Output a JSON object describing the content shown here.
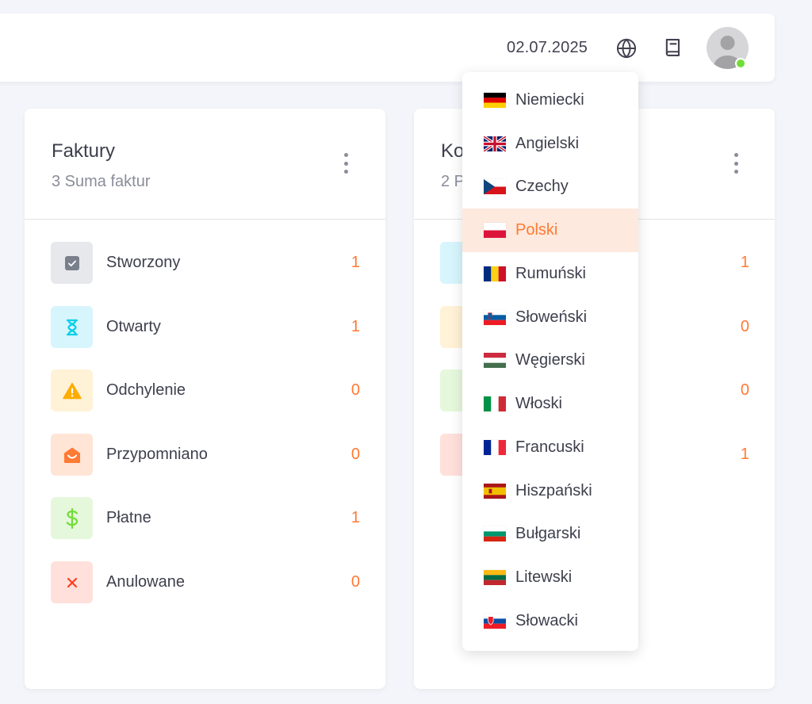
{
  "header": {
    "date": "02.07.2025",
    "icons": [
      "globe-icon",
      "book-icon"
    ],
    "online_status_color": "#71dd37"
  },
  "cards": [
    {
      "title": "Faktury",
      "subtitle": "3 Suma faktur",
      "rows": [
        {
          "label": "Stworzony",
          "count": "1",
          "icon": "checkbox-icon",
          "bg": "#e7e8ec",
          "fg": "#7a7f8c"
        },
        {
          "label": "Otwarty",
          "count": "1",
          "icon": "hourglass-icon",
          "bg": "#d7f5fc",
          "fg": "#00cfe8"
        },
        {
          "label": "Odchylenie",
          "count": "0",
          "icon": "warning-icon",
          "bg": "#fff2d6",
          "fg": "#ffab00"
        },
        {
          "label": "Przypomniano",
          "count": "0",
          "icon": "mail-open-icon",
          "bg": "#ffe5d6",
          "fg": "#ff7a33"
        },
        {
          "label": "Płatne",
          "count": "1",
          "icon": "dollar-icon",
          "bg": "#e6f8dc",
          "fg": "#71dd37"
        },
        {
          "label": "Anulowane",
          "count": "0",
          "icon": "close-icon",
          "bg": "#ffe0db",
          "fg": "#ff3e1d"
        }
      ]
    },
    {
      "title": "Ko",
      "subtitle": "2 P",
      "rows": [
        {
          "count": "1"
        },
        {
          "count": "0"
        },
        {
          "count": "0"
        },
        {
          "count": "1"
        }
      ]
    }
  ],
  "language_menu": {
    "selected": "Polski",
    "items": [
      {
        "label": "Niemiecki",
        "flag": "flag-germany-icon"
      },
      {
        "label": "Angielski",
        "flag": "flag-uk-icon"
      },
      {
        "label": "Czechy",
        "flag": "flag-czech-icon"
      },
      {
        "label": "Polski",
        "flag": "flag-poland-icon"
      },
      {
        "label": "Rumuński",
        "flag": "flag-romania-icon"
      },
      {
        "label": "Słoweński",
        "flag": "flag-slovenia-icon"
      },
      {
        "label": "Węgierski",
        "flag": "flag-hungary-icon"
      },
      {
        "label": "Włoski",
        "flag": "flag-italy-icon"
      },
      {
        "label": "Francuski",
        "flag": "flag-france-icon"
      },
      {
        "label": "Hiszpański",
        "flag": "flag-spain-icon"
      },
      {
        "label": "Bułgarski",
        "flag": "flag-bulgaria-icon"
      },
      {
        "label": "Litewski",
        "flag": "flag-lithuania-icon"
      },
      {
        "label": "Słowacki",
        "flag": "flag-slovakia-icon"
      }
    ],
    "accent_color": "#ff7a33"
  }
}
